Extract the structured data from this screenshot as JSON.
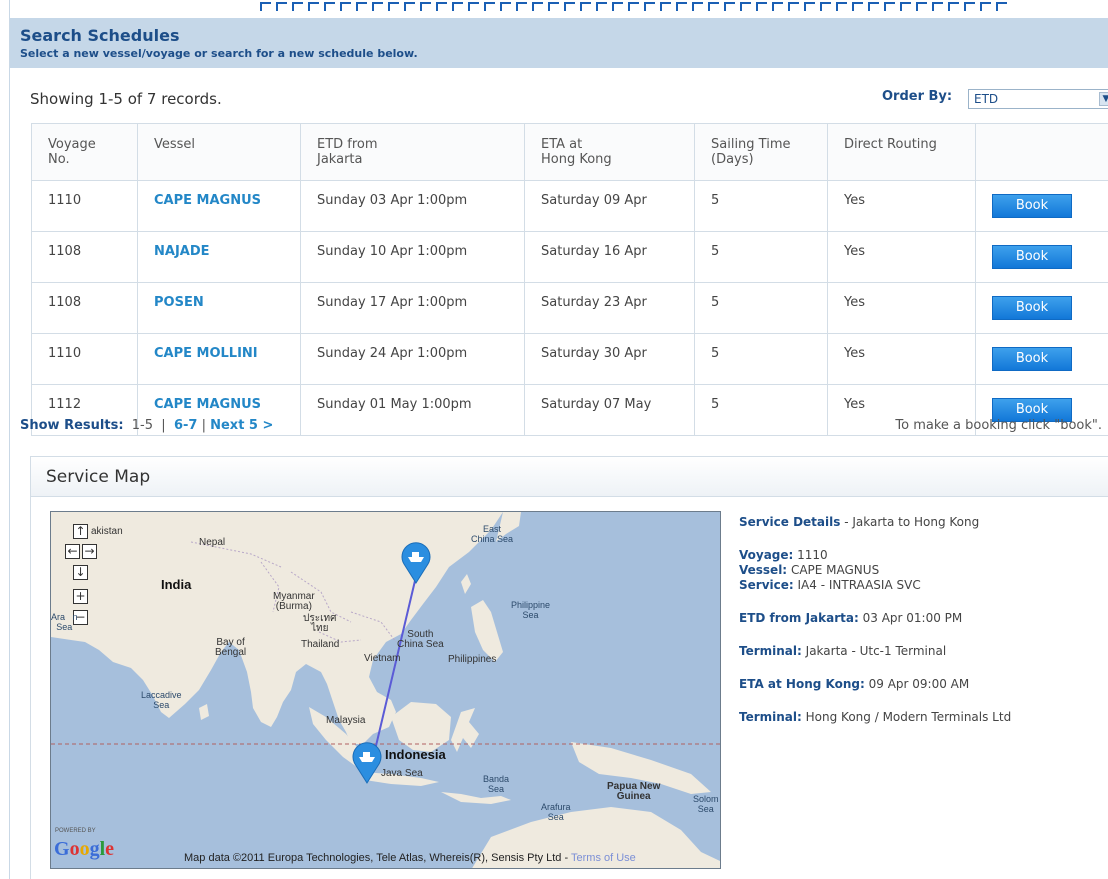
{
  "header": {
    "title": "Search Schedules",
    "subtitle": "Select a new vessel/voyage or search for a new schedule below."
  },
  "records": {
    "showing": "Showing 1-5 of 7 records.",
    "order_by_label": "Order By:",
    "order_by_value": "ETD"
  },
  "table": {
    "headers": [
      "Voyage No.",
      "Vessel",
      "ETD from\nJakarta",
      "ETA at\nHong Kong",
      "Sailing Time\n(Days)",
      "Direct Routing",
      ""
    ],
    "rows": [
      {
        "voyage": "1110",
        "vessel": "CAPE MAGNUS",
        "etd": "Sunday 03 Apr 1:00pm",
        "eta": "Saturday 09 Apr",
        "days": "5",
        "direct": "Yes",
        "book": "Book"
      },
      {
        "voyage": "1108",
        "vessel": "NAJADE",
        "etd": "Sunday 10 Apr 1:00pm",
        "eta": "Saturday 16 Apr",
        "days": "5",
        "direct": "Yes",
        "book": "Book"
      },
      {
        "voyage": "1108",
        "vessel": "POSEN",
        "etd": "Sunday 17 Apr 1:00pm",
        "eta": "Saturday 23 Apr",
        "days": "5",
        "direct": "Yes",
        "book": "Book"
      },
      {
        "voyage": "1110",
        "vessel": "CAPE MOLLINI",
        "etd": "Sunday 24 Apr 1:00pm",
        "eta": "Saturday 30 Apr",
        "days": "5",
        "direct": "Yes",
        "book": "Book"
      },
      {
        "voyage": "1112",
        "vessel": "CAPE MAGNUS",
        "etd": "Sunday 01 May 1:00pm",
        "eta": "Saturday 07 May",
        "days": "5",
        "direct": "Yes",
        "book": "Book"
      }
    ]
  },
  "pagination": {
    "label": "Show Results:",
    "current": "1-5",
    "sep1": "|",
    "page2": "6-7",
    "sep2": "|",
    "next": "Next 5 >",
    "tip": "To make a booking click \"book\"."
  },
  "service_map": {
    "title": "Service Map",
    "controls": {
      "up": "↑",
      "left": "←",
      "right": "→",
      "down": "↓",
      "zoom_in": "+",
      "zoom_out": "−"
    },
    "labels": {
      "pakistan": "akistan",
      "nepal": "Nepal",
      "india": "India",
      "myanmar": "Myanmar\n(Burma)",
      "thai_script": "ประเทศ\nไทย",
      "thailand": "Thailand",
      "arabian_sea": "Ara   n\nSea",
      "bay_of_bengal": "Bay of\nBengal",
      "vietnam": "Vietnam",
      "south_china_sea": "South\nChina Sea",
      "east_china_sea": "East\nChina Sea",
      "philippine_sea": "Philippine\nSea",
      "philippines": "Philippines",
      "laccadive_sea": "Laccadive\nSea",
      "malaysia": "Malaysia",
      "indonesia": "Indonesia",
      "java_sea": "Java Sea",
      "banda_sea": "Banda\nSea",
      "papua": "Papua New\nGuinea",
      "arafura": "Arafura\nSea",
      "solomon": "Solom\nSea"
    },
    "powered_by": "POWERED BY",
    "google": "Google",
    "attribution": "Map data ©2011 Europa Technologies, Tele Atlas, Whereis(R), Sensis Pty Ltd - ",
    "terms": "Terms of Use",
    "colors": {
      "water": "#a6bfdc",
      "land": "#efeadf",
      "route": "#5b5bd6",
      "pin": "#2b8ee0"
    }
  },
  "details": {
    "heading_bold": "Service Details",
    "heading_rest": " - Jakarta to Hong Kong",
    "voyage_label": "Voyage:",
    "voyage": "1110",
    "vessel_label": "Vessel:",
    "vessel": "CAPE MAGNUS",
    "service_label": "Service:",
    "service": "IA4 - INTRAASIA SVC",
    "etd_label": "ETD from Jakarta:",
    "etd": "03 Apr 01:00 PM",
    "terminal1_label": "Terminal:",
    "terminal1": "Jakarta - Utc-1 Terminal",
    "eta_label": "ETA at Hong Kong:",
    "eta": "09 Apr 09:00 AM",
    "terminal2_label": "Terminal:",
    "terminal2": "Hong Kong / Modern Terminals Ltd"
  }
}
